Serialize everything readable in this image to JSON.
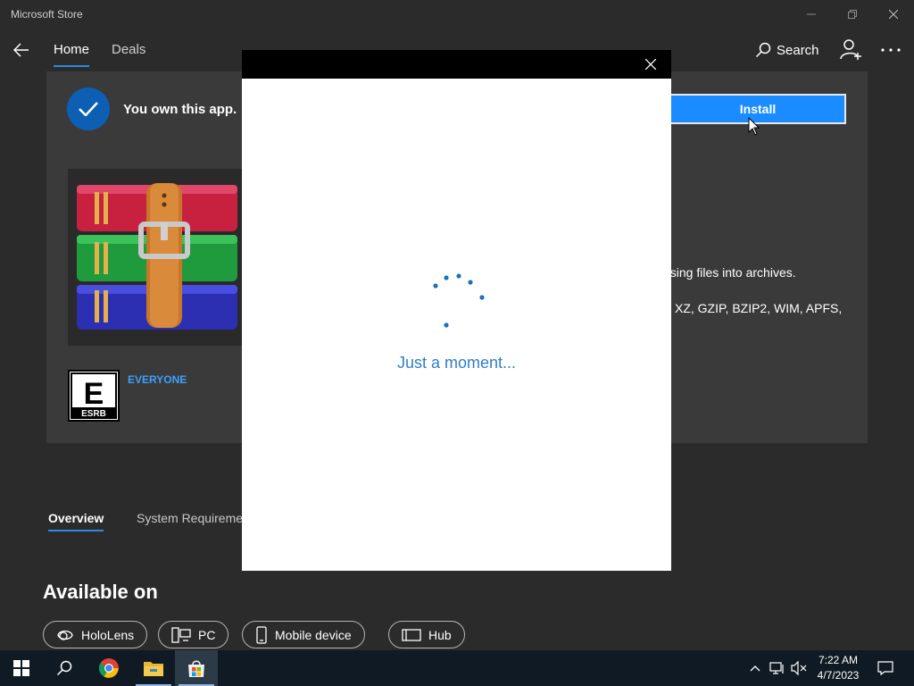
{
  "window": {
    "title": "Microsoft Store"
  },
  "nav": {
    "home": "Home",
    "deals": "Deals",
    "search": "Search"
  },
  "product": {
    "owned_text": "You own this app.",
    "install_label": "Install",
    "desc_line1": "essing files into archives.",
    "desc_line2": "XZ, GZIP, BZIP2, WIM, APFS,",
    "rating": "EVERYONE",
    "esrb_letter": "E",
    "esrb_brand": "ESRB"
  },
  "section_tabs": {
    "overview": "Overview",
    "system_requirements": "System Requireme"
  },
  "available_on": {
    "title": "Available on",
    "platforms": [
      "HoloLens",
      "PC",
      "Mobile device",
      "Hub"
    ]
  },
  "dialog": {
    "message": "Just a moment..."
  },
  "taskbar": {
    "time": "7:22 AM",
    "date": "4/7/2023"
  },
  "colors": {
    "accent": "#1a8cff",
    "link": "#2f7ec7",
    "background": "#2b2b2b"
  }
}
